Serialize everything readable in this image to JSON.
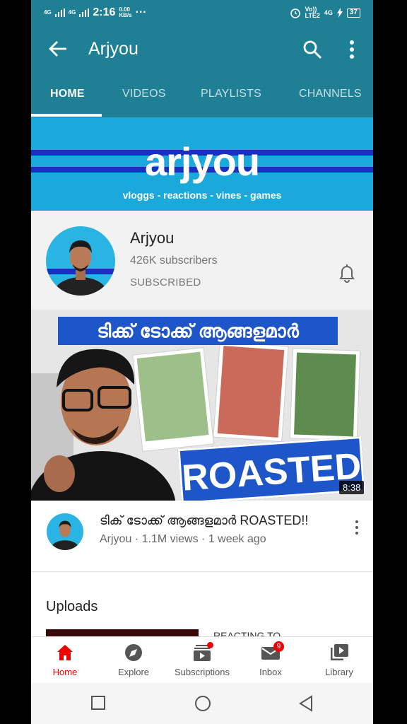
{
  "status_bar": {
    "net1": "4G",
    "net2": "4G",
    "time": "2:16",
    "speed_top": "0.00",
    "speed_bottom": "KB/s",
    "dots": "···",
    "volte_top": "Vo))",
    "volte_bottom": "LTE2",
    "net3": "4G",
    "battery": "37"
  },
  "app_bar": {
    "title": "Arjyou",
    "back_icon": "arrow-left-icon",
    "search_icon": "search-icon",
    "more_icon": "more-vertical-icon"
  },
  "tabs": [
    {
      "label": "HOME",
      "active": true
    },
    {
      "label": "VIDEOS",
      "active": false
    },
    {
      "label": "PLAYLISTS",
      "active": false
    },
    {
      "label": "CHANNELS",
      "active": false
    }
  ],
  "banner": {
    "brand": "arjyou",
    "tagline": "vloggs - reactions - vines - games"
  },
  "channel": {
    "name": "Arjyou",
    "subscribers": "426K subscribers",
    "state": "SUBSCRIBED",
    "bell_icon": "bell-icon"
  },
  "featured_video": {
    "thumb_heading": "ടിക്ക് ടോക്ക് ആങ്ങളമാർ",
    "thumb_overlay": "ROASTED",
    "duration": "8:38",
    "title": "ടിക് ടോക്ക് ആങ്ങളമാർ ROASTED!!",
    "meta": "Arjyou · 1.1M views · 1 week ago"
  },
  "uploads": {
    "heading": "Uploads",
    "first_title": "REACTING TO"
  },
  "bottom_nav": [
    {
      "label": "Home",
      "icon": "home-icon",
      "active": true
    },
    {
      "label": "Explore",
      "icon": "compass-icon",
      "active": false
    },
    {
      "label": "Subscriptions",
      "icon": "subscriptions-icon",
      "active": false
    },
    {
      "label": "Inbox",
      "icon": "mail-icon",
      "active": false,
      "badge": "9"
    },
    {
      "label": "Library",
      "icon": "library-icon",
      "active": false
    }
  ],
  "colors": {
    "app_bar": "#1e7f95",
    "accent_red": "#e00000",
    "banner_blue": "#1ba8db"
  }
}
